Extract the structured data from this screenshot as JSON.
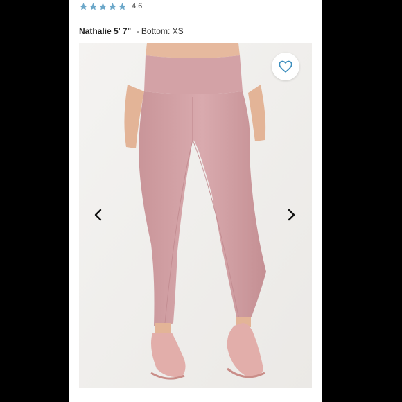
{
  "product": {
    "rating": {
      "star_count": 5,
      "value": "4.6",
      "star_color": "#6ba7c9"
    },
    "model": {
      "name": "Nathalie 5' 7\"",
      "size": "- Bottom: XS"
    },
    "image": {
      "garment_color": "#d7a7ab",
      "favorite_icon": "heart-outline-icon",
      "prev_icon": "chevron-left-icon",
      "next_icon": "chevron-right-icon"
    }
  }
}
